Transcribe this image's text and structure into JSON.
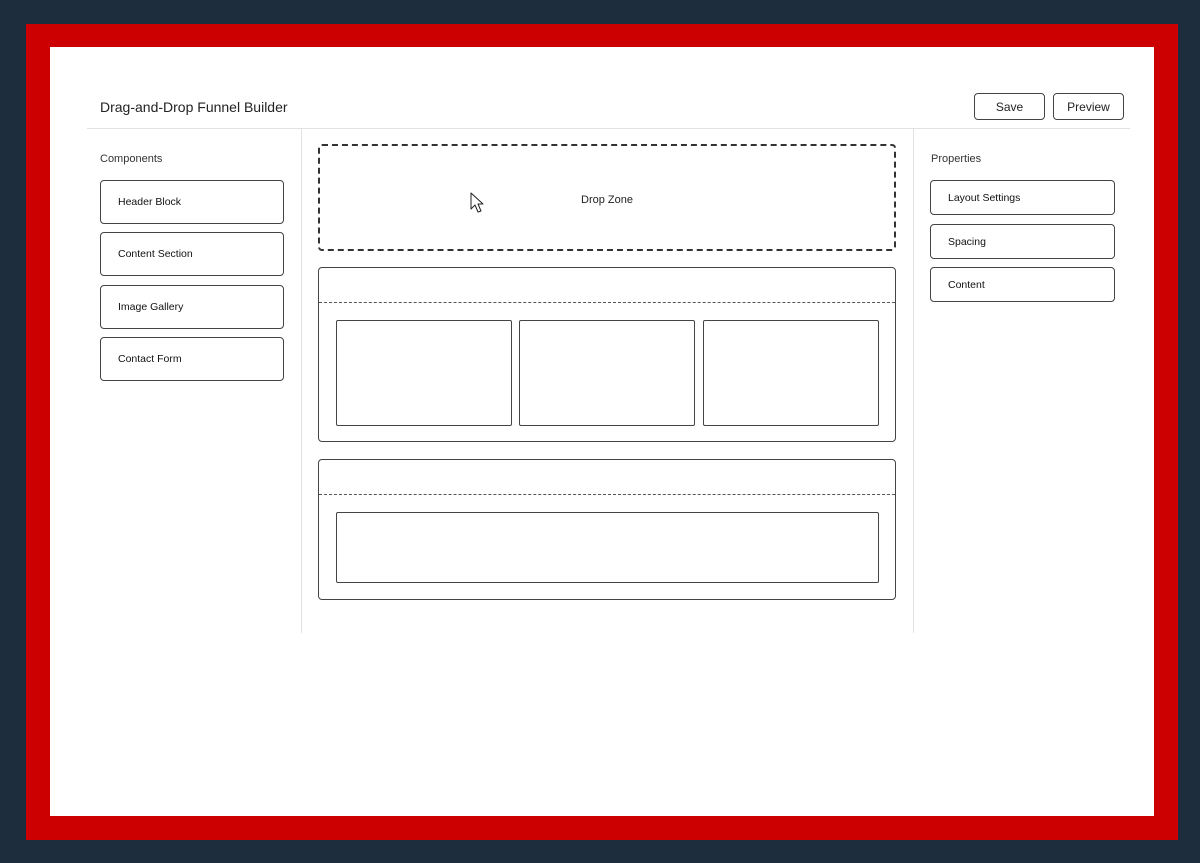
{
  "app": {
    "title": "Drag-and-Drop Funnel Builder"
  },
  "toolbar": {
    "save_label": "Save",
    "preview_label": "Preview"
  },
  "components_panel": {
    "title": "Components",
    "items": [
      {
        "label": "Header Block"
      },
      {
        "label": "Content Section"
      },
      {
        "label": "Image Gallery"
      },
      {
        "label": "Contact Form"
      }
    ]
  },
  "canvas_area": {
    "drop_zone_label": "Drop Zone",
    "cursor_icon": "arrow-pointer-icon"
  },
  "properties_panel": {
    "title": "Properties",
    "items": [
      {
        "label": "Layout Settings"
      },
      {
        "label": "Spacing"
      },
      {
        "label": "Content"
      }
    ]
  },
  "colors": {
    "backdrop": "#1d2d3d",
    "frame": "#cc0000",
    "canvas": "#ffffff",
    "border": "#444444"
  }
}
